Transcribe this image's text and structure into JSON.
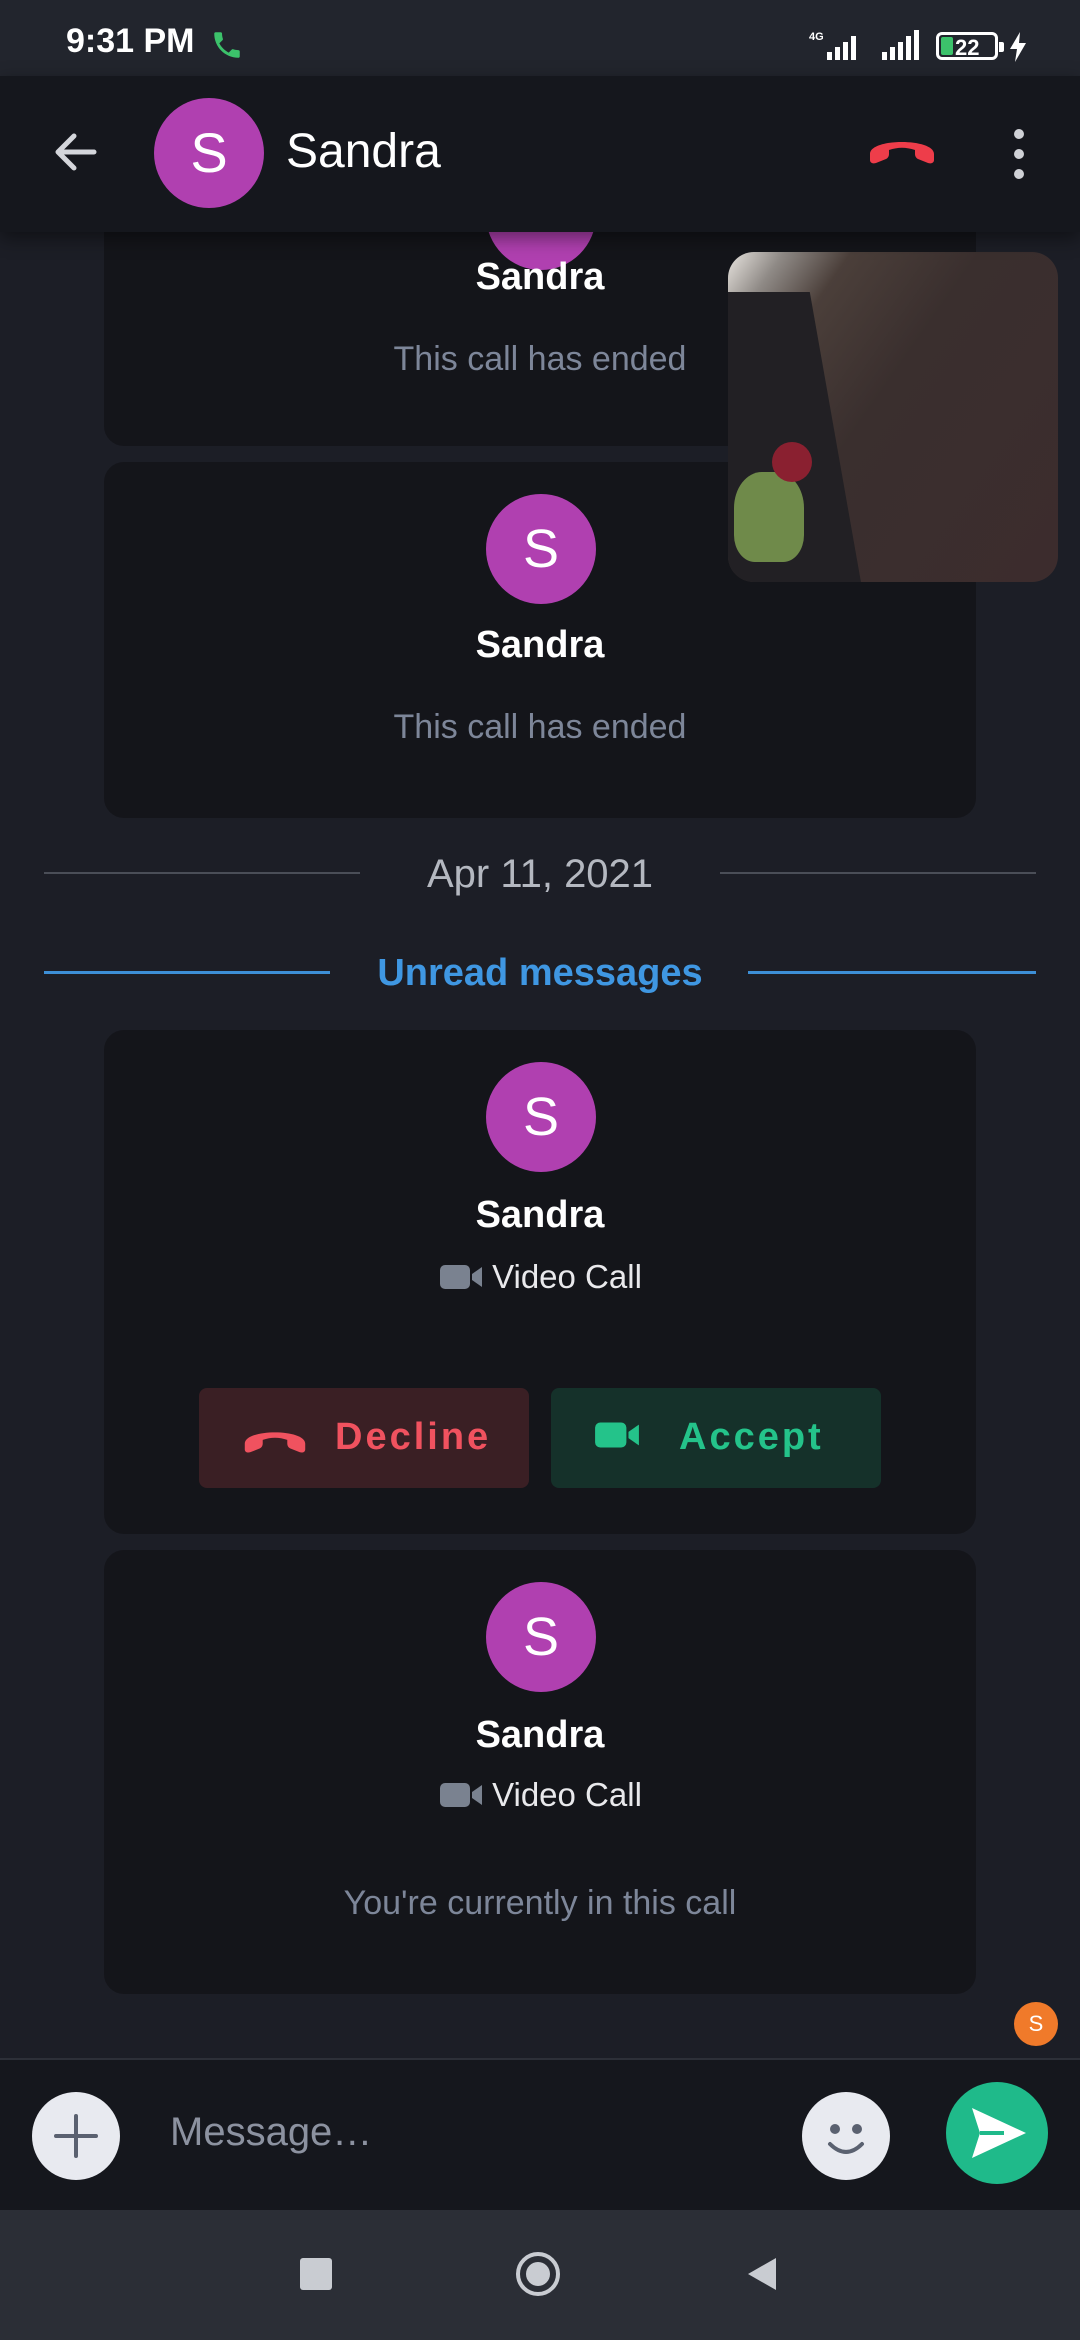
{
  "status_bar": {
    "time": "9:31 PM",
    "network": "4G",
    "battery": "22",
    "battery_level": 0.22,
    "icons": [
      "phone-call-icon",
      "signal-icon",
      "signal-icon",
      "battery-icon",
      "charging-bolt-icon"
    ]
  },
  "header": {
    "avatar_letter": "S",
    "contact_name": "Sandra",
    "icons": [
      "back-arrow-icon",
      "hang-up-icon",
      "more-vert-icon"
    ]
  },
  "cards": [
    {
      "name": "Sandra",
      "note": "This call has ended"
    },
    {
      "avatar_letter": "S",
      "name": "Sandra",
      "note": "This call has ended"
    }
  ],
  "date_divider": "Apr 11, 2021",
  "unread_divider": "Unread messages",
  "incoming_call": {
    "avatar_letter": "S",
    "name": "Sandra",
    "call_type": "Video Call",
    "decline_label": "Decline",
    "accept_label": "Accept"
  },
  "current_call": {
    "avatar_letter": "S",
    "name": "Sandra",
    "call_type": "Video Call",
    "note": "You're currently in this call"
  },
  "typing_indicator_letter": "S",
  "composer": {
    "placeholder": "Message…",
    "icons": [
      "plus-icon",
      "emoji-icon",
      "send-icon"
    ]
  },
  "nav": {
    "icons": [
      "recents-square-icon",
      "home-circle-icon",
      "back-triangle-icon"
    ]
  },
  "colors": {
    "avatar": "#b040b0",
    "decline": "#f0525f",
    "accept": "#24c38a",
    "unread": "#3f97e2",
    "send": "#1fba8a"
  }
}
